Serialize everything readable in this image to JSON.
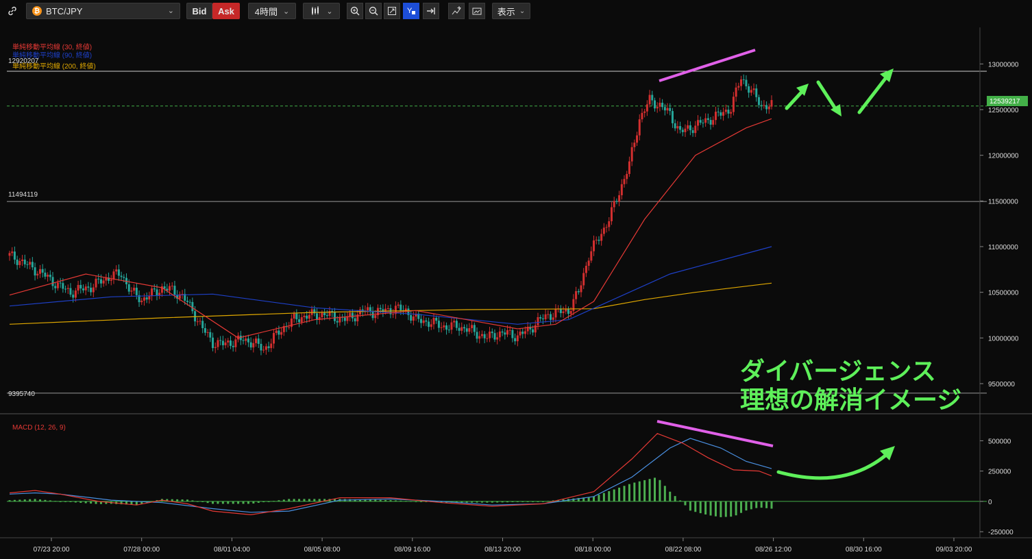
{
  "toolbar": {
    "symbol": "BTC/JPY",
    "bid_label": "Bid",
    "ask_label": "Ask",
    "timeframe": "4時間",
    "display_label": "表示"
  },
  "legend": {
    "sma30": "単純移動平均線 (30, 終値)",
    "sma90": "単純移動平均線 (90, 終値)",
    "sma200": "単純移動平均線 (200, 終値)",
    "macd": "MACD (12, 26, 9)"
  },
  "levels": {
    "upper": "12920207",
    "mid": "11494119",
    "low": "9395740",
    "current": "12539217"
  },
  "annotation": {
    "line1": "ダイバージェンス",
    "line2": "理想の解消イメージ"
  },
  "colors": {
    "up": "#d32f2f",
    "down": "#26a69a",
    "sma30": "#e53935",
    "sma90": "#1e40c8",
    "sma200": "#e0a800",
    "macd": "#e53935",
    "signal": "#4a90e2",
    "histogram": "#4caf50",
    "arrow": "#5ef05a",
    "divergence": "#e060e8"
  },
  "chart_data": [
    {
      "type": "candlestick",
      "x_tick_labels": [
        "07/23 20:00",
        "07/28 00:00",
        "08/01 04:00",
        "08/05 08:00",
        "08/09 16:00",
        "08/13 20:00",
        "08/18 00:00",
        "08/22 08:00",
        "08/26 12:00",
        "08/30 16:00",
        "09/03 20:00"
      ],
      "y_tick_labels": [
        "13000000",
        "12500000",
        "12000000",
        "11500000",
        "11000000",
        "10500000",
        "10000000",
        "9500000"
      ],
      "ylim": [
        9200000,
        13400000
      ],
      "price_line_points": [
        [
          0,
          10900000
        ],
        [
          4,
          10850000
        ],
        [
          8,
          10780000
        ],
        [
          12,
          10720000
        ],
        [
          16,
          10640000
        ],
        [
          20,
          10560000
        ],
        [
          24,
          10500000
        ],
        [
          28,
          10530000
        ],
        [
          32,
          10560000
        ],
        [
          36,
          10620000
        ],
        [
          40,
          10680000
        ],
        [
          44,
          10700000
        ],
        [
          48,
          10500000
        ],
        [
          52,
          10420000
        ],
        [
          56,
          10480000
        ],
        [
          60,
          10550000
        ],
        [
          64,
          10520000
        ],
        [
          68,
          10460000
        ],
        [
          72,
          10300000
        ],
        [
          76,
          10100000
        ],
        [
          80,
          9950000
        ],
        [
          84,
          9930000
        ],
        [
          88,
          9960000
        ],
        [
          92,
          9980000
        ],
        [
          96,
          9950000
        ],
        [
          100,
          9870000
        ],
        [
          104,
          10000000
        ],
        [
          108,
          10120000
        ],
        [
          112,
          10200000
        ],
        [
          116,
          10240000
        ],
        [
          120,
          10250000
        ],
        [
          124,
          10260000
        ],
        [
          128,
          10230000
        ],
        [
          132,
          10200000
        ],
        [
          136,
          10250000
        ],
        [
          140,
          10300000
        ],
        [
          144,
          10280000
        ],
        [
          148,
          10300000
        ],
        [
          152,
          10320000
        ],
        [
          156,
          10300000
        ],
        [
          160,
          10200000
        ],
        [
          164,
          10180000
        ],
        [
          168,
          10150000
        ],
        [
          172,
          10120000
        ],
        [
          176,
          10130000
        ],
        [
          180,
          10100000
        ],
        [
          184,
          10050000
        ],
        [
          188,
          10000000
        ],
        [
          192,
          10050000
        ],
        [
          196,
          10050000
        ],
        [
          200,
          10020000
        ],
        [
          204,
          10080000
        ],
        [
          208,
          10180000
        ],
        [
          212,
          10250000
        ],
        [
          216,
          10280000
        ],
        [
          220,
          10300000
        ],
        [
          224,
          10500000
        ],
        [
          228,
          10900000
        ],
        [
          232,
          11100000
        ],
        [
          236,
          11300000
        ],
        [
          240,
          11600000
        ],
        [
          244,
          11900000
        ],
        [
          248,
          12400000
        ],
        [
          252,
          12600000
        ],
        [
          256,
          12550000
        ],
        [
          260,
          12450000
        ],
        [
          264,
          12250000
        ],
        [
          268,
          12300000
        ],
        [
          272,
          12350000
        ],
        [
          276,
          12400000
        ],
        [
          280,
          12450000
        ],
        [
          284,
          12520000
        ],
        [
          288,
          12850000
        ],
        [
          292,
          12700000
        ],
        [
          296,
          12550000
        ],
        [
          300,
          12540000
        ]
      ],
      "sma30_points": [
        [
          0,
          10470000
        ],
        [
          30,
          10700000
        ],
        [
          60,
          10550000
        ],
        [
          90,
          10000000
        ],
        [
          120,
          10200000
        ],
        [
          160,
          10300000
        ],
        [
          200,
          10100000
        ],
        [
          215,
          10150000
        ],
        [
          230,
          10400000
        ],
        [
          250,
          11300000
        ],
        [
          270,
          12000000
        ],
        [
          290,
          12300000
        ],
        [
          300,
          12400000
        ]
      ],
      "sma90_points": [
        [
          0,
          10350000
        ],
        [
          40,
          10450000
        ],
        [
          80,
          10480000
        ],
        [
          120,
          10330000
        ],
        [
          160,
          10260000
        ],
        [
          200,
          10150000
        ],
        [
          220,
          10200000
        ],
        [
          240,
          10450000
        ],
        [
          260,
          10700000
        ],
        [
          280,
          10850000
        ],
        [
          300,
          11000000
        ]
      ],
      "sma200_points": [
        [
          0,
          10150000
        ],
        [
          60,
          10220000
        ],
        [
          120,
          10280000
        ],
        [
          180,
          10310000
        ],
        [
          230,
          10320000
        ],
        [
          250,
          10420000
        ],
        [
          270,
          10500000
        ],
        [
          300,
          10600000
        ]
      ]
    },
    {
      "type": "line",
      "title": "MACD (12, 26, 9)",
      "y_tick_labels": [
        "500000",
        "250000",
        "0",
        "-250000"
      ],
      "ylim": [
        -300000,
        700000
      ],
      "macd_points": [
        [
          0,
          70000
        ],
        [
          10,
          90000
        ],
        [
          20,
          60000
        ],
        [
          35,
          0
        ],
        [
          50,
          -30000
        ],
        [
          60,
          10000
        ],
        [
          70,
          -20000
        ],
        [
          80,
          -80000
        ],
        [
          95,
          -110000
        ],
        [
          110,
          -60000
        ],
        [
          130,
          30000
        ],
        [
          150,
          30000
        ],
        [
          170,
          -10000
        ],
        [
          190,
          -40000
        ],
        [
          210,
          -20000
        ],
        [
          230,
          80000
        ],
        [
          245,
          350000
        ],
        [
          255,
          560000
        ],
        [
          265,
          480000
        ],
        [
          275,
          360000
        ],
        [
          285,
          260000
        ],
        [
          295,
          250000
        ],
        [
          300,
          210000
        ]
      ],
      "signal_points": [
        [
          0,
          60000
        ],
        [
          10,
          70000
        ],
        [
          20,
          60000
        ],
        [
          40,
          10000
        ],
        [
          60,
          -10000
        ],
        [
          80,
          -60000
        ],
        [
          95,
          -90000
        ],
        [
          110,
          -80000
        ],
        [
          130,
          10000
        ],
        [
          150,
          20000
        ],
        [
          170,
          0
        ],
        [
          190,
          -30000
        ],
        [
          210,
          -20000
        ],
        [
          230,
          40000
        ],
        [
          245,
          200000
        ],
        [
          260,
          440000
        ],
        [
          268,
          520000
        ],
        [
          280,
          440000
        ],
        [
          290,
          330000
        ],
        [
          300,
          270000
        ]
      ]
    }
  ]
}
